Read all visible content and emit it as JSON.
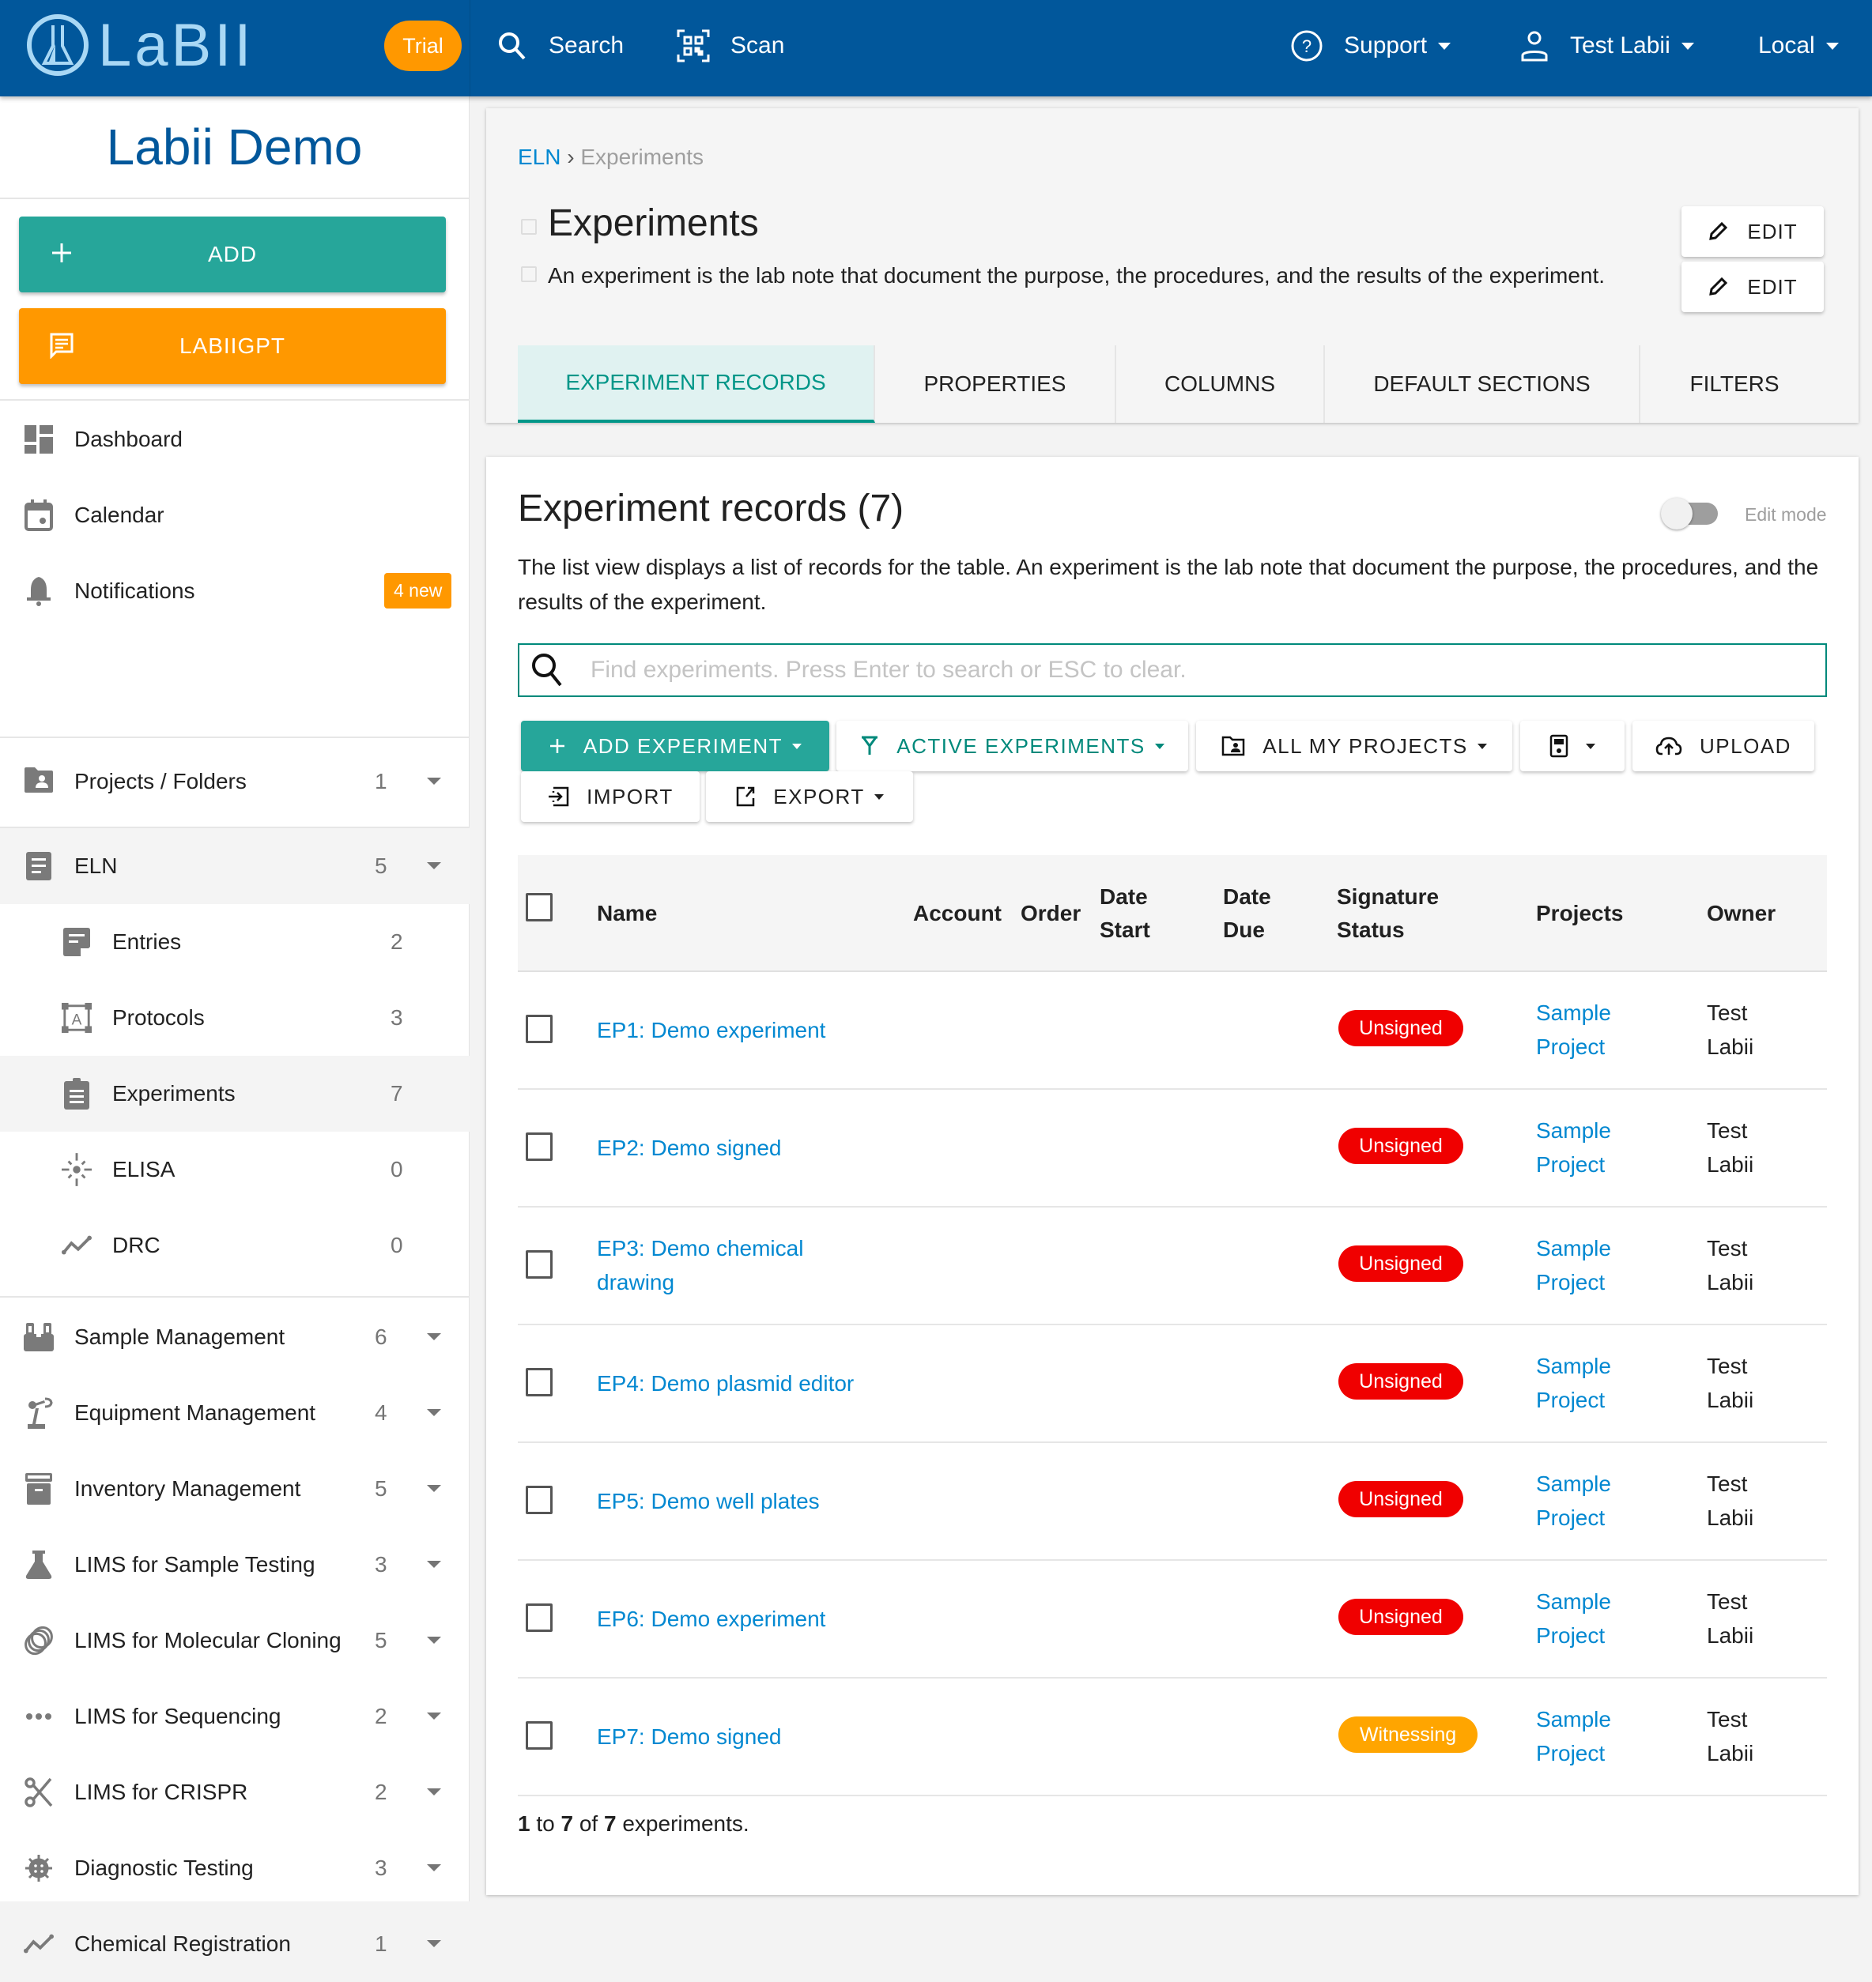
{
  "topbar": {
    "logo_text": "LaBII",
    "trial_label": "Trial",
    "search_label": "Search",
    "scan_label": "Scan",
    "support_label": "Support",
    "user_label": "Test Labii",
    "locale_label": "Local"
  },
  "sidebar": {
    "org_name": "Labii Demo",
    "add_label": "ADD",
    "gpt_label": "LABIIGPT",
    "top_items": [
      {
        "label": "Dashboard"
      },
      {
        "label": "Calendar"
      },
      {
        "label": "Notifications",
        "badge": "4 new"
      }
    ],
    "projects": {
      "label": "Projects / Folders",
      "count": "1"
    },
    "eln": {
      "label": "ELN",
      "count": "5"
    },
    "eln_children": [
      {
        "label": "Entries",
        "count": "2"
      },
      {
        "label": "Protocols",
        "count": "3"
      },
      {
        "label": "Experiments",
        "count": "7"
      },
      {
        "label": "ELISA",
        "count": "0"
      },
      {
        "label": "DRC",
        "count": "0"
      }
    ],
    "modules": [
      {
        "label": "Sample Management",
        "count": "6"
      },
      {
        "label": "Equipment Management",
        "count": "4"
      },
      {
        "label": "Inventory Management",
        "count": "5"
      },
      {
        "label": "LIMS for Sample Testing",
        "count": "3"
      },
      {
        "label": "LIMS for Molecular Cloning",
        "count": "5"
      },
      {
        "label": "LIMS for Sequencing",
        "count": "2"
      },
      {
        "label": "LIMS for CRISPR",
        "count": "2"
      },
      {
        "label": "Diagnostic Testing",
        "count": "3"
      },
      {
        "label": "Chemical Registration",
        "count": "1"
      }
    ]
  },
  "header": {
    "breadcrumb_root": "ELN",
    "breadcrumb_sep": "›",
    "breadcrumb_current": "Experiments",
    "title": "Experiments",
    "description": "An experiment is the lab note that document the purpose, the procedures, and the results of the experiment.",
    "edit_label": "EDIT",
    "tabs": [
      {
        "label": "EXPERIMENT RECORDS",
        "active": true
      },
      {
        "label": "PROPERTIES"
      },
      {
        "label": "COLUMNS"
      },
      {
        "label": "DEFAULT SECTIONS"
      },
      {
        "label": "FILTERS"
      }
    ]
  },
  "records": {
    "title": "Experiment records (7)",
    "edit_mode_label": "Edit mode",
    "edit_mode_on": false,
    "description": "The list view displays a list of records for the table. An experiment is the lab note that document the purpose, the procedures, and the results of the experiment.",
    "search_placeholder": "Find experiments. Press Enter to search or ESC to clear.",
    "search_value": "",
    "toolbar": {
      "add": "ADD EXPERIMENT",
      "filter": "ACTIVE EXPERIMENTS",
      "projects": "ALL MY PROJECTS",
      "upload": "UPLOAD",
      "import": "IMPORT",
      "export": "EXPORT"
    },
    "columns": {
      "name": "Name",
      "account": "Account",
      "order": "Order",
      "date_start_1": "Date",
      "date_start_2": "Start",
      "date_due_1": "Date",
      "date_due_2": "Due",
      "sig_1": "Signature",
      "sig_2": "Status",
      "projects": "Projects",
      "owner": "Owner"
    },
    "rows": [
      {
        "name": "EP1: Demo experiment",
        "status": "Unsigned",
        "project_1": "Sample",
        "project_2": "Project",
        "owner_1": "Test",
        "owner_2": "Labii"
      },
      {
        "name": "EP2: Demo signed",
        "status": "Unsigned",
        "project_1": "Sample",
        "project_2": "Project",
        "owner_1": "Test",
        "owner_2": "Labii"
      },
      {
        "name": "EP3: Demo chemical drawing",
        "status": "Unsigned",
        "project_1": "Sample",
        "project_2": "Project",
        "owner_1": "Test",
        "owner_2": "Labii"
      },
      {
        "name": "EP4: Demo plasmid editor",
        "status": "Unsigned",
        "project_1": "Sample",
        "project_2": "Project",
        "owner_1": "Test",
        "owner_2": "Labii"
      },
      {
        "name": "EP5: Demo well plates",
        "status": "Unsigned",
        "project_1": "Sample",
        "project_2": "Project",
        "owner_1": "Test",
        "owner_2": "Labii"
      },
      {
        "name": "EP6: Demo experiment",
        "status": "Unsigned",
        "project_1": "Sample",
        "project_2": "Project",
        "owner_1": "Test",
        "owner_2": "Labii"
      },
      {
        "name": "EP7: Demo signed",
        "status": "Witnessing",
        "project_1": "Sample",
        "project_2": "Project",
        "owner_1": "Test",
        "owner_2": "Labii"
      }
    ],
    "pagination": {
      "from": "1",
      "to_word": " to ",
      "to": "7",
      "of_word": " of ",
      "total": "7",
      "suffix": " experiments."
    }
  },
  "colors": {
    "brand": "#01579b",
    "accent": "#26a69a",
    "orange": "#ff9800",
    "link": "#0288d1",
    "unsigned": "#f00000",
    "witnessing": "#ffa500"
  }
}
